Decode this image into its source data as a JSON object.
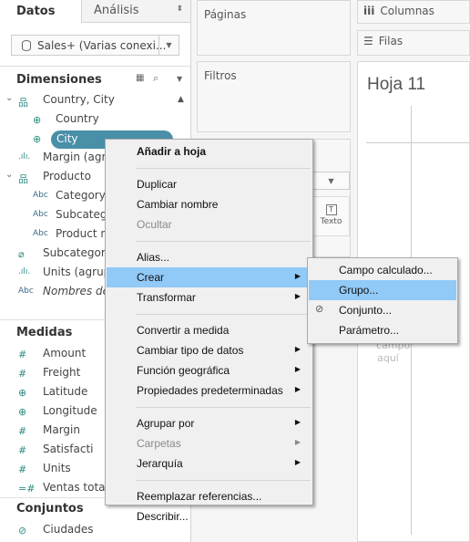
{
  "tabs": {
    "datos": "Datos",
    "analisis": "Análisis"
  },
  "datasource": "Sales+ (Varias conexi...",
  "dimensions": {
    "title": "Dimensiones",
    "items": [
      {
        "label": "Country, City",
        "icon": "hierarchy-icon",
        "glyph": "品",
        "indent": 0,
        "chev": true
      },
      {
        "label": "Country",
        "icon": "globe-icon",
        "glyph": "⊕",
        "indent": 1
      },
      {
        "label": "City",
        "icon": "globe-icon",
        "glyph": "⊕",
        "indent": 1,
        "selected": true
      },
      {
        "label": "Margin (agrup",
        "icon": "bin-icon",
        "glyph": ".ılı.",
        "indent": 0
      },
      {
        "label": "Producto",
        "icon": "hierarchy-icon",
        "glyph": "品",
        "indent": 0,
        "chev": true
      },
      {
        "label": "Category",
        "icon": "abc-icon",
        "glyph": "Abc",
        "indent": 1
      },
      {
        "label": "Subcateg",
        "icon": "abc-icon",
        "glyph": "Abc",
        "indent": 1
      },
      {
        "label": "Product n",
        "icon": "abc-icon",
        "glyph": "Abc",
        "indent": 1
      },
      {
        "label": "Subcategory",
        "icon": "paperclip-icon",
        "glyph": "⌀",
        "indent": 0
      },
      {
        "label": "Units (agrup",
        "icon": "bin-icon",
        "glyph": ".ılı.",
        "indent": 0
      },
      {
        "label": "Nombres de",
        "icon": "abc-icon",
        "glyph": "Abc",
        "indent": 0,
        "italic": true
      }
    ]
  },
  "measures": {
    "title": "Medidas",
    "items": [
      {
        "label": "Amount",
        "icon": "hash-icon",
        "glyph": "#"
      },
      {
        "label": "Freight",
        "icon": "hash-icon",
        "glyph": "#"
      },
      {
        "label": "Latitude",
        "icon": "globe-icon",
        "glyph": "⊕"
      },
      {
        "label": "Longitude",
        "icon": "globe-icon",
        "glyph": "⊕"
      },
      {
        "label": "Margin",
        "icon": "hash-icon",
        "glyph": "#"
      },
      {
        "label": "Satisfacti",
        "icon": "hash-icon",
        "glyph": "#"
      },
      {
        "label": "Units",
        "icon": "hash-icon",
        "glyph": "#"
      },
      {
        "label": "Ventas total",
        "icon": "calc-hash-icon",
        "glyph": "=#",
        "outdent": true
      }
    ]
  },
  "sets": {
    "title": "Conjuntos",
    "items": [
      {
        "label": "Ciudades",
        "icon": "set-icon",
        "glyph": "⊘"
      }
    ]
  },
  "cards": {
    "pages": "Páginas",
    "filters": "Filtros",
    "marks_text": "Texto"
  },
  "shelves": {
    "columns": "Columnas",
    "rows": "Filas"
  },
  "sheet": {
    "title": "Hoja 11",
    "drop_hint_1": "campo",
    "drop_hint_2": "aquí"
  },
  "context_menu": [
    {
      "label": "Añadir a hoja",
      "bold": true
    },
    {
      "sep": true
    },
    {
      "label": "Duplicar"
    },
    {
      "label": "Cambiar nombre"
    },
    {
      "label": "Ocultar",
      "disabled": true
    },
    {
      "sep": true
    },
    {
      "label": "Alias..."
    },
    {
      "label": "Crear",
      "submenu": true,
      "highlighted": true
    },
    {
      "label": "Transformar",
      "submenu": true
    },
    {
      "sep": true
    },
    {
      "label": "Convertir a medida"
    },
    {
      "label": "Cambiar tipo de datos",
      "submenu": true
    },
    {
      "label": "Función geográfica",
      "submenu": true
    },
    {
      "label": "Propiedades predeterminadas",
      "submenu": true
    },
    {
      "sep": true
    },
    {
      "label": "Agrupar por",
      "submenu": true
    },
    {
      "label": "Carpetas",
      "submenu": true,
      "disabled": true
    },
    {
      "label": "Jerarquía",
      "submenu": true
    },
    {
      "sep": true
    },
    {
      "label": "Reemplazar referencias..."
    },
    {
      "label": "Describir..."
    }
  ],
  "submenu": [
    {
      "label": "Campo calculado..."
    },
    {
      "label": "Grupo...",
      "highlighted": true
    },
    {
      "label": "Conjunto...",
      "icon": "set-icon"
    },
    {
      "label": "Parámetro..."
    }
  ],
  "colors": {
    "accent": "#4a8fa8",
    "highlight": "#91c9f7",
    "icon": "#2e8b83"
  }
}
